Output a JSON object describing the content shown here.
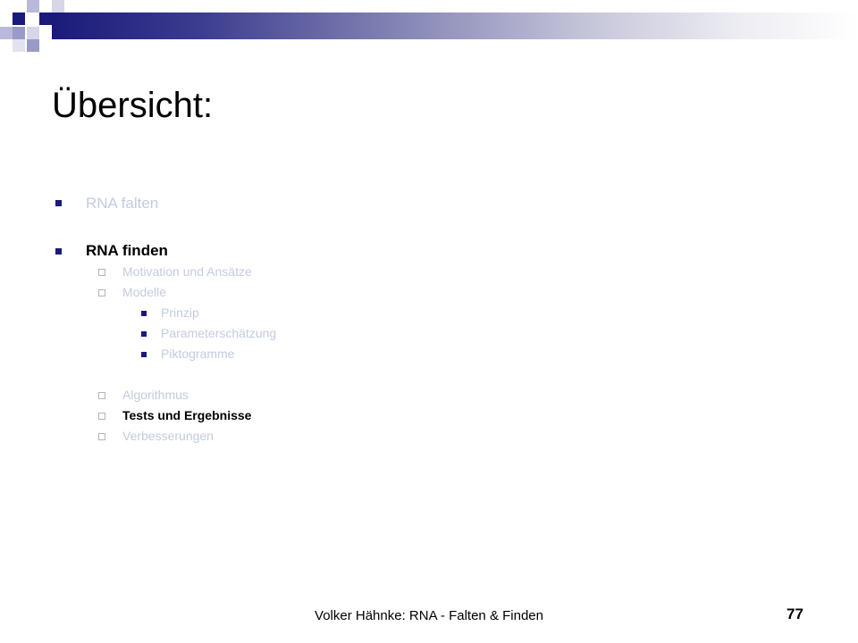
{
  "slide": {
    "title": "Übersicht:",
    "outline": [
      {
        "level": 1,
        "text": "RNA falten",
        "state": "dimmed"
      },
      {
        "level": 1,
        "text": "RNA finden",
        "state": "active"
      },
      {
        "level": 2,
        "text": "Motivation und Ansätze",
        "state": "dimmed"
      },
      {
        "level": 2,
        "text": "Modelle",
        "state": "dimmed"
      },
      {
        "level": 3,
        "text": "Prinzip",
        "state": "dimmed"
      },
      {
        "level": 3,
        "text": "Parameterschätzung",
        "state": "dimmed"
      },
      {
        "level": 3,
        "text": "Piktogramme",
        "state": "dimmed"
      },
      {
        "level": 2,
        "text": "Algorithmus",
        "state": "dimmed"
      },
      {
        "level": 2,
        "text": "Tests und Ergebnisse",
        "state": "active"
      },
      {
        "level": 2,
        "text": "Verbesserungen",
        "state": "dimmed"
      }
    ],
    "footer": "Volker Hähnke: RNA - Falten & Finden",
    "page_number": "77"
  },
  "colors": {
    "accent_dark": "#1a1a7a",
    "accent_light": "#9a9ac8",
    "dimmed_text": "#c4cbe0",
    "active_text": "#000000"
  }
}
